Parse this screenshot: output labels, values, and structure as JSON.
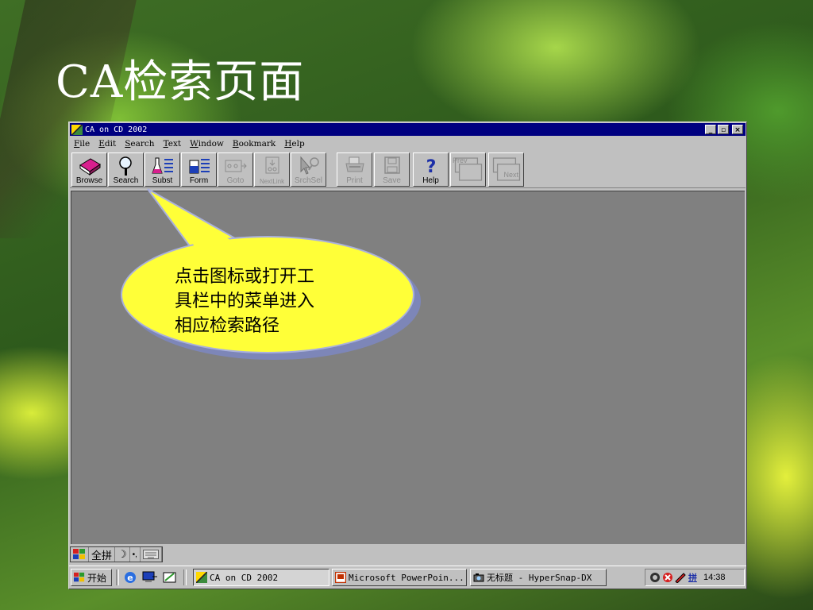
{
  "slide": {
    "title": "CA检索页面"
  },
  "window": {
    "title": "CA on CD 2002",
    "controls": {
      "minimize": "_",
      "restore": "▫",
      "close": "×"
    }
  },
  "menu": [
    {
      "prefix": "",
      "ul": "F",
      "rest": "ile"
    },
    {
      "prefix": "",
      "ul": "E",
      "rest": "dit"
    },
    {
      "prefix": "",
      "ul": "S",
      "rest": "earch"
    },
    {
      "prefix": "",
      "ul": "T",
      "rest": "ext"
    },
    {
      "prefix": "",
      "ul": "W",
      "rest": "indow"
    },
    {
      "prefix": "",
      "ul": "B",
      "rest": "ookmark"
    },
    {
      "prefix": "",
      "ul": "H",
      "rest": "elp"
    }
  ],
  "toolbar": [
    {
      "label": "Browse",
      "icon": "book-icon",
      "enabled": true
    },
    {
      "label": "Search",
      "icon": "magnifier-icon",
      "enabled": true
    },
    {
      "label": "Subst",
      "icon": "flask-icon",
      "enabled": true
    },
    {
      "label": "Form",
      "icon": "beaker-icon",
      "enabled": true
    },
    {
      "label": "Goto",
      "icon": "goto-icon",
      "enabled": false
    },
    {
      "label": "NextLink",
      "icon": "nextlink-icon",
      "enabled": false
    },
    {
      "label": "SrchSel",
      "icon": "cursor-search-icon",
      "enabled": false
    },
    {
      "label": "Print",
      "icon": "printer-icon",
      "enabled": false
    },
    {
      "label": "Save",
      "icon": "disk-icon",
      "enabled": false
    },
    {
      "label": "Help",
      "icon": "question-icon",
      "enabled": true
    },
    {
      "label": "Prev",
      "icon": "prev-page-icon",
      "enabled": false
    },
    {
      "label": "Next",
      "icon": "next-page-icon",
      "enabled": false
    }
  ],
  "callout": {
    "lines": [
      "点击图标或打开工",
      "具栏中的菜单进入",
      "相应检索路径"
    ]
  },
  "ime": {
    "mode": "全拼",
    "moon": "☽",
    "punct": "•,",
    "keyboard": "keyboard-icon"
  },
  "taskbar": {
    "start": "开始",
    "tasks": [
      {
        "label": "CA on CD 2002",
        "icon": "ca-app-icon",
        "active": true
      },
      {
        "label": "Microsoft PowerPoin...",
        "icon": "powerpoint-icon",
        "active": false
      },
      {
        "label": "无标题 - HyperSnap-DX",
        "icon": "camera-icon",
        "active": false
      }
    ],
    "tray": {
      "ime": "拼",
      "clock": "14:38"
    }
  },
  "colors": {
    "titlebar": "#000080",
    "client": "#808080",
    "callout": "#ffff38",
    "callout_shadow": "#7d86b8"
  }
}
